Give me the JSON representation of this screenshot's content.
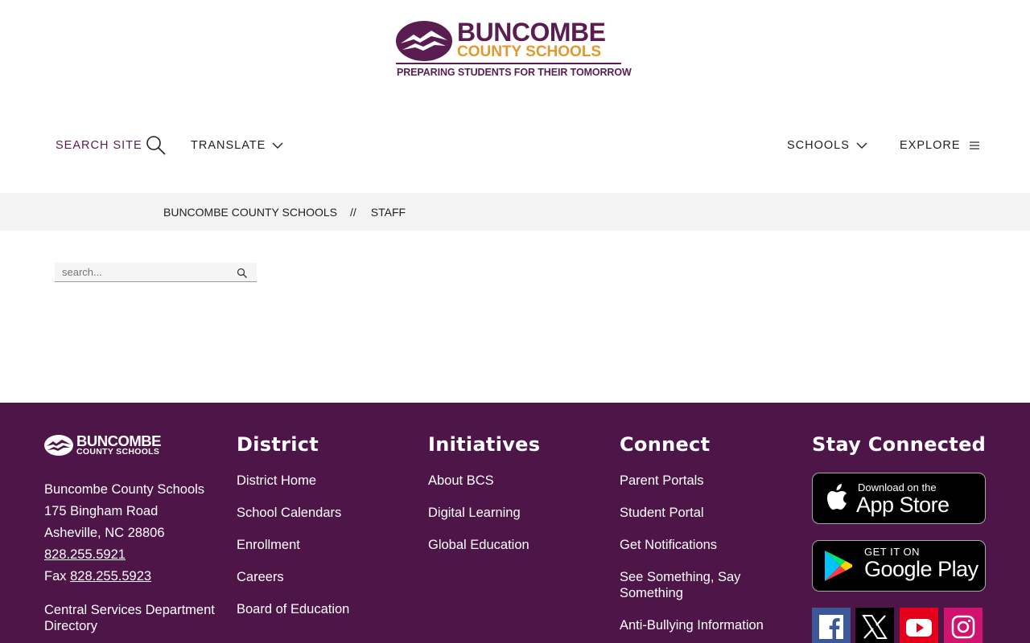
{
  "header": {
    "logo": {
      "title": "BUNCOMBE",
      "subtitle": "COUNTY SCHOOLS",
      "tagline": "PREPARING STUDENTS FOR THEIR TOMORROW"
    },
    "nav": {
      "search_label": "SEARCH SITE",
      "translate_label": "TRANSLATE",
      "schools_label": "SCHOOLS",
      "explore_label": "EXPLORE"
    }
  },
  "breadcrumb": {
    "root": "BUNCOMBE COUNTY SCHOOLS",
    "separator": "//",
    "current": "STAFF"
  },
  "staff_search": {
    "placeholder": "search...",
    "value": ""
  },
  "footer": {
    "logo": {
      "title": "BUNCOMBE",
      "subtitle": "COUNTY SCHOOLS"
    },
    "address": {
      "name": "Buncombe County Schools",
      "street": "175 Bingham Road",
      "city": "Asheville, NC 28806",
      "phone": "828.255.5921",
      "fax_label": "Fax",
      "fax": "828.255.5923"
    },
    "directory_link": "Central Services Department Directory",
    "district": {
      "heading": "District",
      "links": [
        "District Home",
        "School Calendars",
        "Enrollment",
        "Careers",
        "Board of Education"
      ]
    },
    "initiatives": {
      "heading": "Initiatives",
      "links": [
        "About BCS",
        "Digital Learning",
        "Global Education"
      ]
    },
    "connect": {
      "heading": "Connect",
      "links": [
        "Parent Portals",
        "Student Portal",
        "Get Notifications",
        "See Something, Say Something",
        "Anti-Bullying Information"
      ]
    },
    "stay_connected": {
      "heading": "Stay Connected",
      "app_store": {
        "small": "Download on the",
        "big": "App Store"
      },
      "google_play": {
        "small": "GET IT ON",
        "big": "Google Play"
      },
      "social": [
        "facebook-icon",
        "x-icon",
        "youtube-icon",
        "instagram-icon"
      ]
    }
  },
  "colors": {
    "brand_purple": "#5a1d52",
    "footer_bg": "#4e1548",
    "brand_gold": "#e0982f",
    "breadcrumb_bg": "#f3f3f3"
  }
}
